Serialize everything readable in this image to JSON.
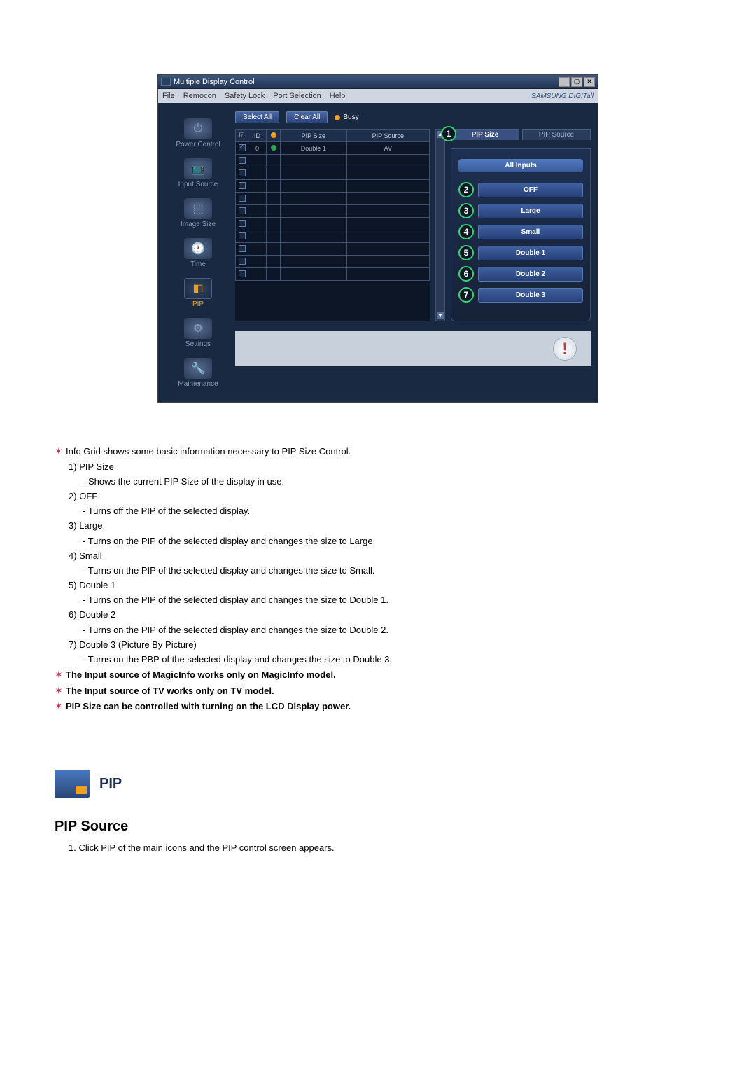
{
  "window": {
    "title": "Multiple Display Control",
    "menus": [
      "File",
      "Remocon",
      "Safety Lock",
      "Port Selection",
      "Help"
    ],
    "brand": "SAMSUNG DIGITall"
  },
  "sidebar": {
    "items": [
      {
        "label": "Power Control"
      },
      {
        "label": "Input Source"
      },
      {
        "label": "Image Size"
      },
      {
        "label": "Time"
      },
      {
        "label": "PIP"
      },
      {
        "label": "Settings"
      },
      {
        "label": "Maintenance"
      }
    ]
  },
  "toolbar": {
    "select_all": "Select All",
    "clear_all": "Clear All",
    "busy": "Busy"
  },
  "grid": {
    "headers": {
      "checkbox": "☑",
      "id": "ID",
      "status": " ",
      "pip_size": "PIP Size",
      "pip_source": "PIP Source"
    },
    "row0": {
      "id": "0",
      "pip_size": "Double 1",
      "pip_source": "AV"
    }
  },
  "right": {
    "tab_size": "PIP Size",
    "tab_source": "PIP Source",
    "all_inputs": "All Inputs",
    "callout1": "1",
    "options": [
      {
        "num": "2",
        "label": "OFF"
      },
      {
        "num": "3",
        "label": "Large"
      },
      {
        "num": "4",
        "label": "Small"
      },
      {
        "num": "5",
        "label": "Double 1"
      },
      {
        "num": "6",
        "label": "Double 2"
      },
      {
        "num": "7",
        "label": "Double 3"
      }
    ]
  },
  "doc": {
    "intro": "Info Grid shows some basic information necessary to PIP Size Control.",
    "items": [
      {
        "head": "PIP Size",
        "desc": "- Shows the current PIP Size of the display in use."
      },
      {
        "head": "OFF",
        "desc": "- Turns off the PIP of the selected display."
      },
      {
        "head": "Large",
        "desc": "- Turns on the PIP of the selected display and changes the size to Large."
      },
      {
        "head": "Small",
        "desc": "- Turns on the PIP of the selected display and changes the size to Small."
      },
      {
        "head": "Double 1",
        "desc": "- Turns on the PIP of the selected display and changes the size to Double 1."
      },
      {
        "head": "Double 2",
        "desc": "- Turns on the PIP of the selected display and changes the size to Double 2."
      },
      {
        "head": "Double 3 (Picture By Picture)",
        "desc": "- Turns on the PBP of the selected display and changes the size to Double 3."
      }
    ],
    "notes": [
      "The Input source of MagicInfo works only on MagicInfo model.",
      "The Input source of TV works only on TV model.",
      "PIP Size can be controlled with turning on the LCD Display power."
    ],
    "numbered_prefix": [
      "1)",
      "2)",
      "3)",
      "4)",
      "5)",
      "6)",
      "7)"
    ]
  },
  "pip_section": {
    "title": "PIP",
    "subtitle": "PIP Source",
    "step1_prefix": "1.",
    "step1": "Click PIP of the main icons and the PIP control screen appears."
  }
}
